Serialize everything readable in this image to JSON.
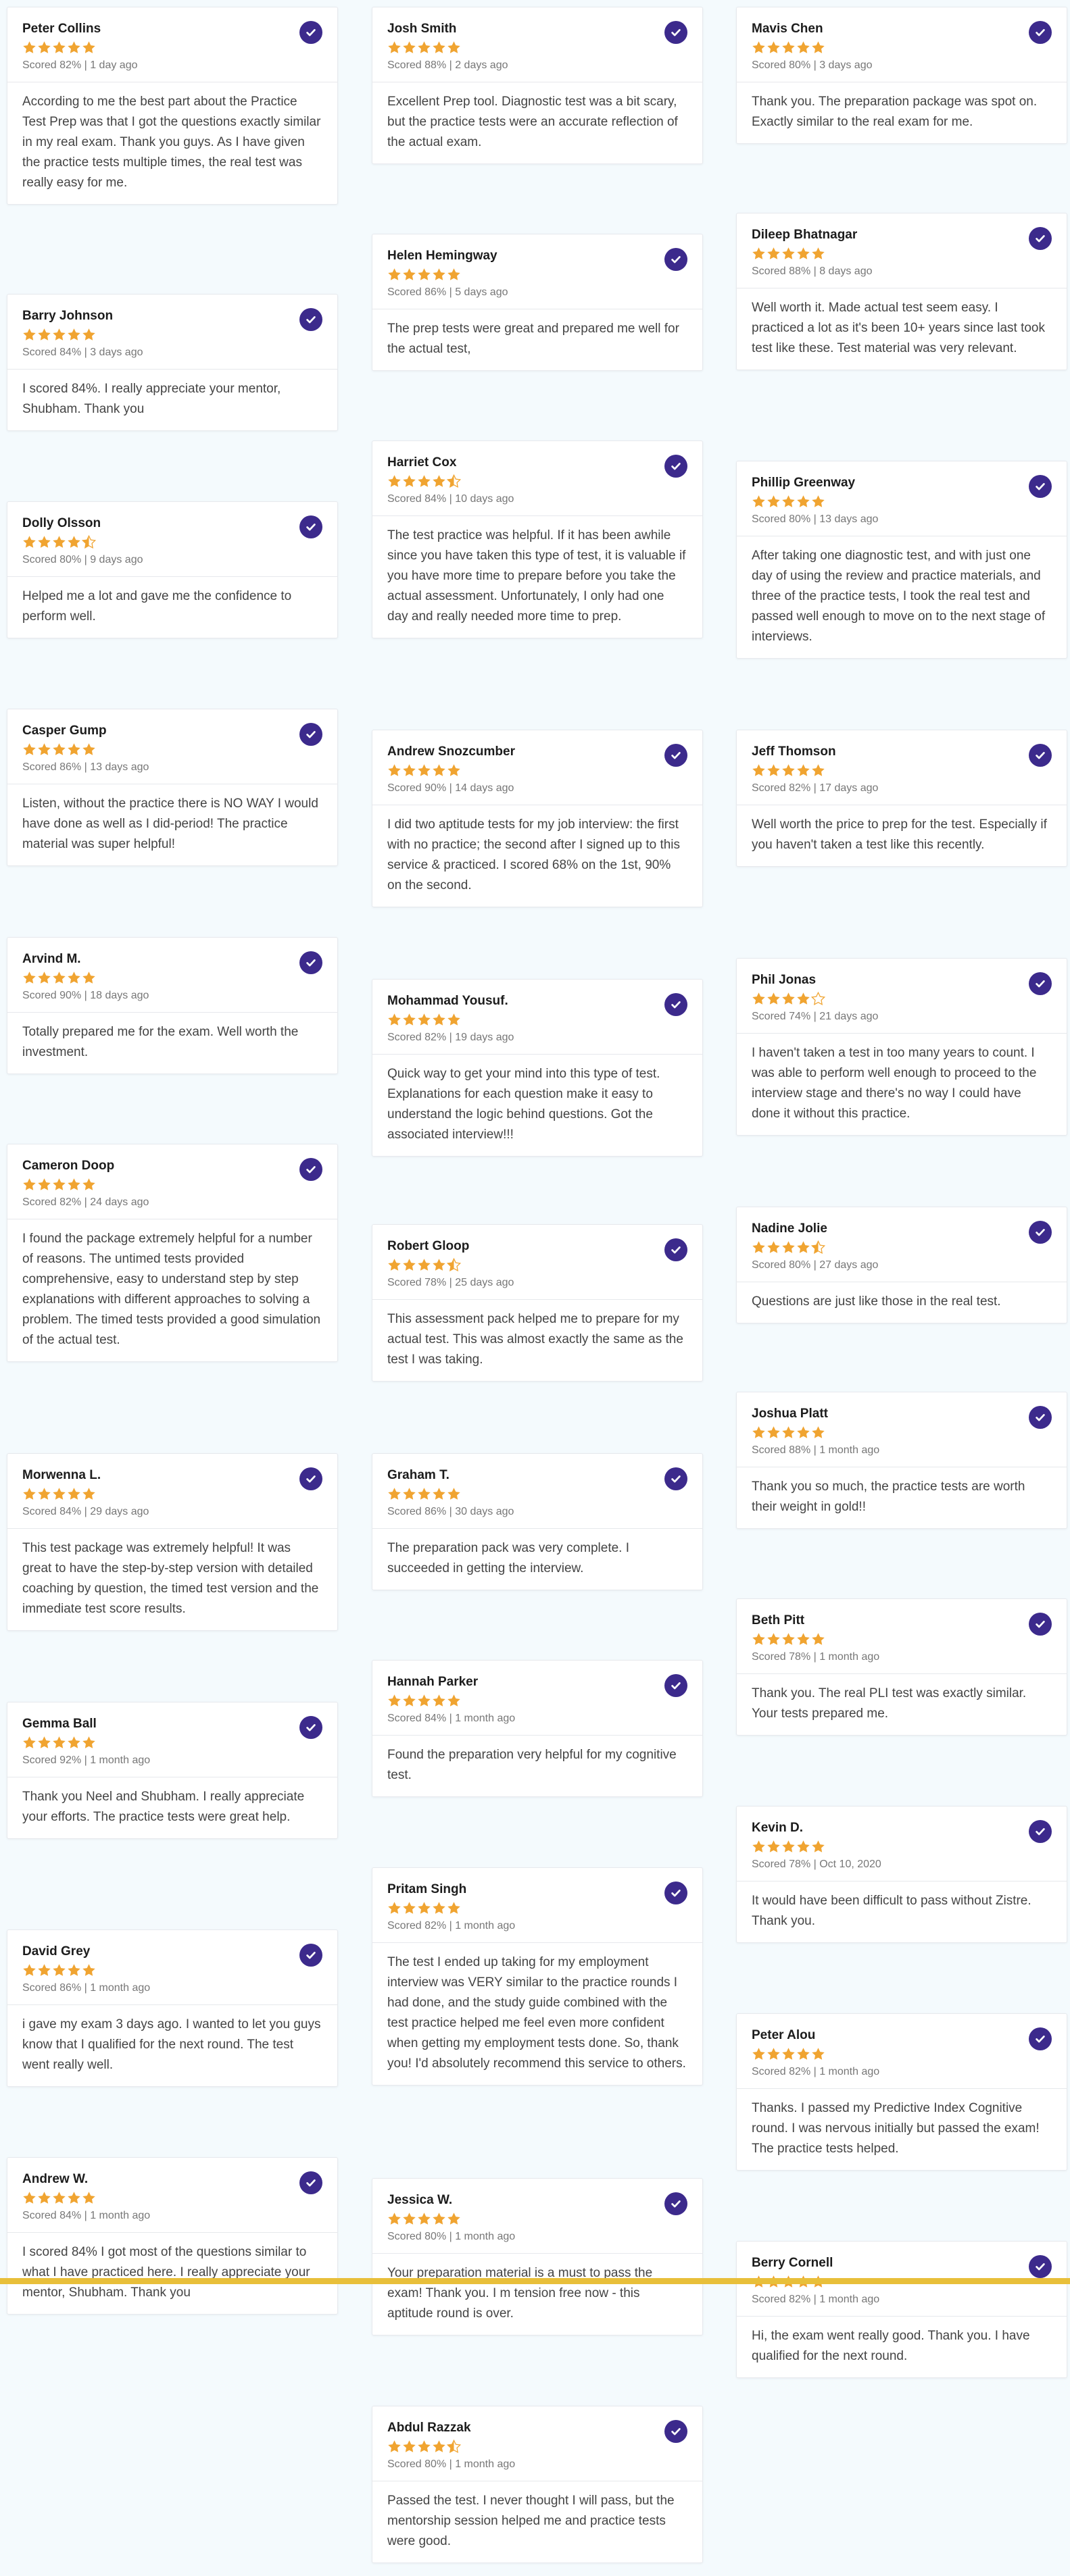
{
  "colors": {
    "star": "#f0a431",
    "star_empty": "#d9d9d9",
    "check_bg": "#3c2a8c",
    "divider": "#e8bf3a"
  },
  "icons": {
    "verified": "check-circle-icon",
    "rating": "star-icon"
  },
  "columns": [
    [
      {
        "name": "Peter Collins",
        "rating": 5,
        "meta": "Scored 82% | 1 day ago",
        "text": "According to me the best part about the Practice Test Prep was that I got the questions exactly similar in my real exam. Thank you guys. As I have given the practice tests multiple times, the real test was really easy for me."
      },
      {
        "name": "Barry Johnson",
        "rating": 5,
        "meta": "Scored 84% | 3 days ago",
        "text": "I scored 84%. I really appreciate your mentor, Shubham. Thank you"
      },
      {
        "name": "Dolly Olsson",
        "rating": 4.5,
        "meta": "Scored 80% | 9 days ago",
        "text": "Helped me a lot and gave me the confidence to perform well."
      },
      {
        "name": "Casper Gump",
        "rating": 5,
        "meta": "Scored 86% | 13 days ago",
        "text": "Listen, without the practice there is NO WAY I would have done as well as I did-period! The practice material was super helpful!"
      },
      {
        "name": "Arvind M.",
        "rating": 5,
        "meta": "Scored 90% | 18 days ago",
        "text": "Totally prepared me for the exam. Well worth the investment."
      },
      {
        "name": "Cameron Doop",
        "rating": 5,
        "meta": "Scored 82% | 24 days ago",
        "text": "I found the package extremely helpful for a number of reasons. The untimed tests provided comprehensive, easy to understand step by step explanations with different approaches to solving a problem. The timed tests provided a good simulation of the actual test."
      },
      {
        "name": "Morwenna L.",
        "rating": 5,
        "meta": "Scored 84% | 29 days ago",
        "text": "This test package was extremely helpful! It was great to have the step-by-step version with detailed coaching by question, the timed test version and the immediate test score results."
      },
      {
        "name": "Gemma Ball",
        "rating": 5,
        "meta": "Scored 92% | 1 month ago",
        "text": "Thank you Neel and Shubham. I really appreciate your efforts. The practice tests were great help."
      },
      {
        "name": "David Grey",
        "rating": 5,
        "meta": "Scored 86% | 1 month ago",
        "text": "i gave my exam 3 days ago. I wanted to let you guys know that I qualified for the next round. The test went really well."
      },
      {
        "name": "Andrew W.",
        "rating": 5,
        "meta": "Scored 84% | 1 month ago",
        "text": "I scored 84% I got most of the questions similar to what I have practiced here. I really appreciate your mentor, Shubham. Thank you"
      }
    ],
    [
      {
        "name": "Josh Smith",
        "rating": 5,
        "meta": "Scored 88% | 2 days ago",
        "text": "Excellent Prep tool. Diagnostic test was a bit scary, but the practice tests were an accurate reflection of the actual exam."
      },
      {
        "name": "Helen Hemingway",
        "rating": 5,
        "meta": "Scored 86% | 5 days ago",
        "text": "The prep tests were great and prepared me well for the actual test,"
      },
      {
        "name": "Harriet Cox",
        "rating": 4.5,
        "meta": "Scored 84% | 10 days ago",
        "text": "The test practice was helpful. If it has been awhile since you have taken this type of test, it is valuable if you have more time to prepare before you take the actual assessment. Unfortunately, I only had one day and really needed more time to prep."
      },
      {
        "name": "Andrew Snozcumber",
        "rating": 5,
        "meta": "Scored 90% | 14 days ago",
        "text": "I did two aptitude tests for my job interview: the first with no practice; the second after I signed up to this service & practiced. I scored 68% on the 1st, 90% on the second."
      },
      {
        "name": "Mohammad Yousuf.",
        "rating": 5,
        "meta": "Scored 82% | 19 days ago",
        "text": "Quick way to get your mind into this type of test. Explanations for each question make it easy to understand the logic behind questions. Got the associated interview!!!"
      },
      {
        "name": "Robert Gloop",
        "rating": 4.5,
        "meta": "Scored 78% | 25 days ago",
        "text": "This assessment pack helped me to prepare for my actual test. This was almost exactly the same as the test I was taking."
      },
      {
        "name": "Graham T.",
        "rating": 5,
        "meta": "Scored 86% | 30 days ago",
        "text": "The preparation pack was very complete. I succeeded in getting the interview."
      },
      {
        "name": "Hannah Parker",
        "rating": 5,
        "meta": "Scored 84% | 1 month ago",
        "text": "Found the preparation very helpful for my cognitive test."
      },
      {
        "name": "Pritam Singh",
        "rating": 5,
        "meta": "Scored 82% | 1 month ago",
        "text": "The test I ended up taking for my employment interview was VERY similar to the practice rounds I had done, and the study guide combined with the test practice helped me feel even more confident when getting my employment tests done. So, thank you! I'd absolutely recommend this service to others."
      },
      {
        "name": "Jessica W.",
        "rating": 5,
        "meta": "Scored 80% | 1 month ago",
        "text": "Your preparation material is a must to pass the exam! Thank you. I m tension free now - this aptitude round is over."
      },
      {
        "name": "Abdul Razzak",
        "rating": 4.5,
        "meta": "Scored 80% | 1 month ago",
        "text": "Passed the test. I never thought I will pass, but the mentorship session helped me and practice tests were good."
      }
    ],
    [
      {
        "name": "Mavis Chen",
        "rating": 5,
        "meta": "Scored 80% | 3 days ago",
        "text": "Thank you. The preparation package was spot on. Exactly similar to the real exam for me."
      },
      {
        "name": "Dileep Bhatnagar",
        "rating": 5,
        "meta": "Scored 88% | 8 days ago",
        "text": "Well worth it. Made actual test seem easy. I practiced a lot as it's been 10+ years since last took test like these. Test material was very relevant."
      },
      {
        "name": "Phillip Greenway",
        "rating": 5,
        "meta": "Scored 80% | 13 days ago",
        "text": "After taking one diagnostic test, and with just one day of using the review and practice materials, and three of the practice tests, I took the real test and passed well enough to move on to the next stage of interviews."
      },
      {
        "name": "Jeff Thomson",
        "rating": 5,
        "meta": "Scored 82% | 17 days ago",
        "text": "Well worth the price to prep for the test. Especially if you haven't taken a test like this recently."
      },
      {
        "name": "Phil Jonas",
        "rating": 4,
        "meta": "Scored 74% | 21 days ago",
        "text": "I haven't taken a test in too many years to count. I was able to perform well enough to proceed to the interview stage and there's no way I could have done it without this practice."
      },
      {
        "name": "Nadine Jolie",
        "rating": 4.5,
        "meta": "Scored 80% | 27 days ago",
        "text": "Questions are just like those in the real test."
      },
      {
        "name": "Joshua Platt",
        "rating": 5,
        "meta": "Scored 88% | 1 month ago",
        "text": "Thank you so much, the practice tests are worth their weight in gold!!"
      },
      {
        "name": "Beth Pitt",
        "rating": 5,
        "meta": "Scored 78% | 1 month ago",
        "text": "Thank you. The real PLI test was exactly similar. Your tests prepared me."
      },
      {
        "name": "Kevin D.",
        "rating": 5,
        "meta": "Scored 78% | Oct 10, 2020",
        "text": "It would have been difficult to pass without Zistre. Thank you."
      },
      {
        "name": "Peter Alou",
        "rating": 5,
        "meta": "Scored 82% | 1 month ago",
        "text": "Thanks. I passed my Predictive Index Cognitive round. I was nervous initially but passed the exam! The practice tests helped."
      },
      {
        "name": "Berry Cornell",
        "rating": 5,
        "meta": "Scored 82% | 1 month ago",
        "text": "Hi, the exam went really good. Thank you. I have qualified for the next round."
      }
    ]
  ]
}
